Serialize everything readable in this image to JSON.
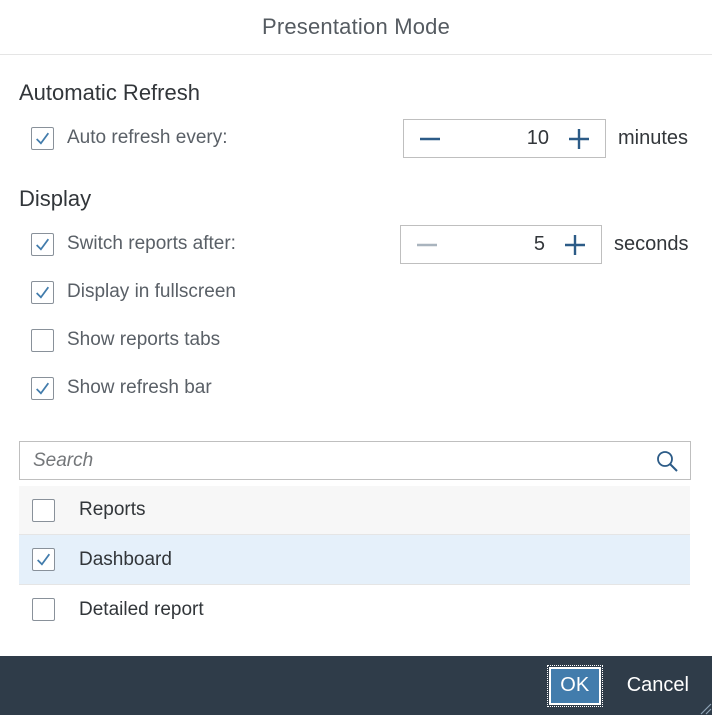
{
  "dialog": {
    "title": "Presentation Mode"
  },
  "auto_refresh": {
    "section_title": "Automatic Refresh",
    "label": "Auto refresh every:",
    "checked": true,
    "value": "10",
    "unit": "minutes"
  },
  "display": {
    "section_title": "Display",
    "switch_reports": {
      "label": "Switch reports after:",
      "checked": true,
      "value": "5",
      "unit": "seconds"
    },
    "fullscreen": {
      "label": "Display in fullscreen",
      "checked": true
    },
    "report_tabs": {
      "label": "Show reports tabs",
      "checked": false
    },
    "refresh_bar": {
      "label": "Show refresh bar",
      "checked": true
    }
  },
  "search": {
    "placeholder": "Search",
    "value": ""
  },
  "list": {
    "items": [
      {
        "label": "Reports",
        "checked": false
      },
      {
        "label": "Dashboard",
        "checked": true
      },
      {
        "label": "Detailed report",
        "checked": false
      }
    ]
  },
  "footer": {
    "ok_label": "OK",
    "cancel_label": "Cancel"
  },
  "colors": {
    "accent": "#427cac",
    "footer_bg": "#2f3c49",
    "selected_row": "#e5f0fa",
    "check": "#427cac"
  },
  "icons": {
    "check": "check-icon",
    "minus": "minus-icon",
    "plus": "plus-icon",
    "search": "search-icon"
  }
}
